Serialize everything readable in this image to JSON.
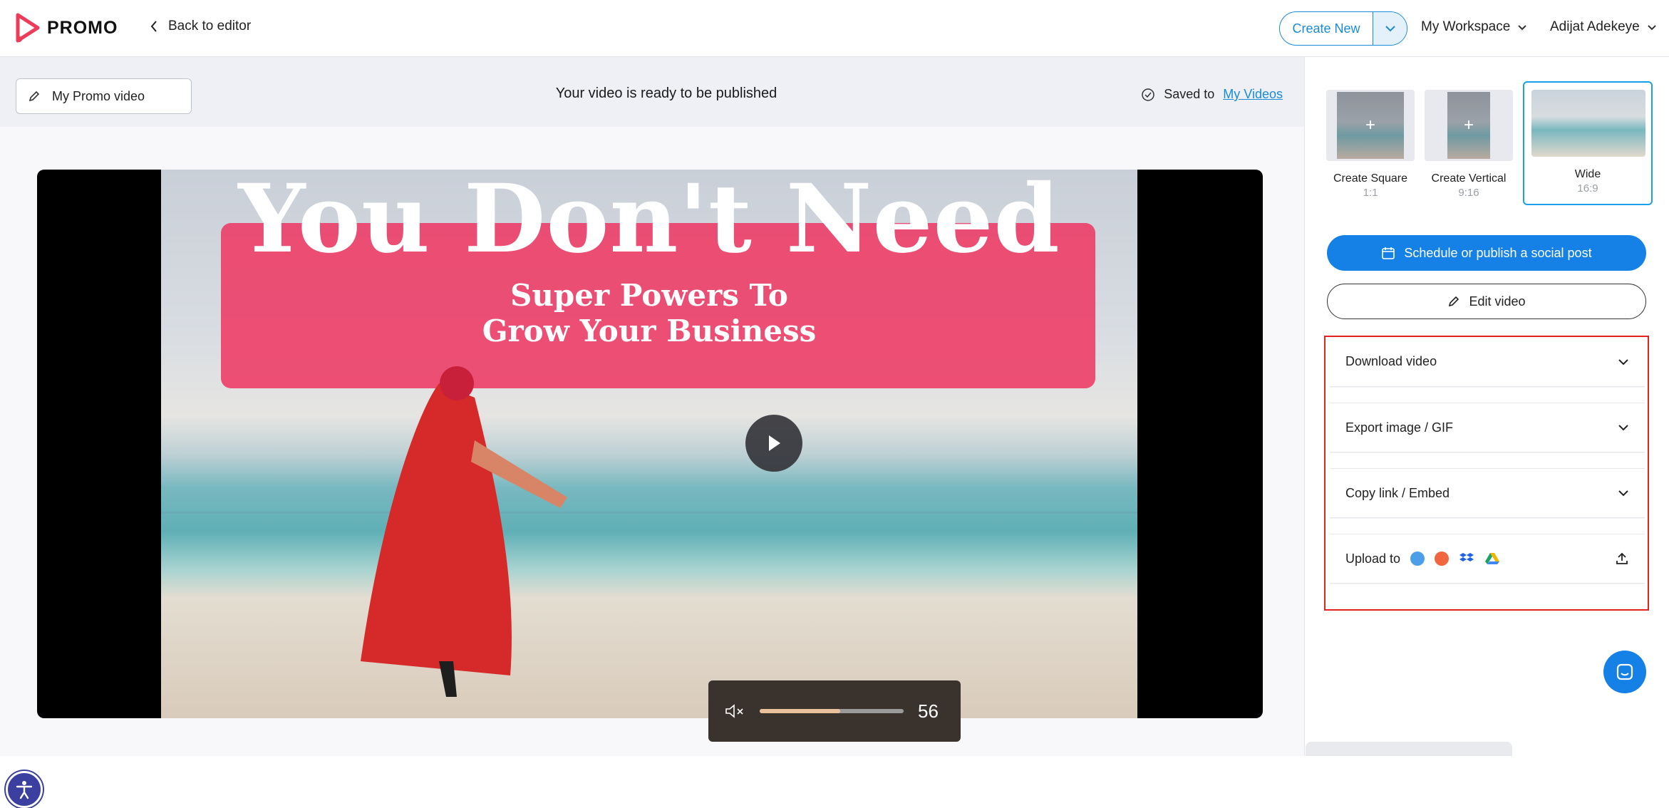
{
  "header": {
    "logo_text": "PROMO",
    "back_label": "Back to editor",
    "create_new_label": "Create New",
    "workspace_label": "My Workspace",
    "user_name": "Adijat Adekeye"
  },
  "subbar": {
    "video_title": "My Promo video",
    "status_message": "Your video is ready to be published",
    "saved_prefix": "Saved to",
    "saved_link": "My Videos"
  },
  "video": {
    "headline": "You Don't Need",
    "subline_1": "Super Powers To",
    "subline_2": "Grow Your Business"
  },
  "volume": {
    "value": "56",
    "level_fraction": 0.56
  },
  "formats": [
    {
      "label": "Create Square",
      "ratio": "1:1"
    },
    {
      "label": "Create Vertical",
      "ratio": "9:16"
    },
    {
      "label": "Wide",
      "ratio": "16:9"
    }
  ],
  "actions": {
    "schedule_label": "Schedule or publish a social post",
    "edit_label": "Edit video"
  },
  "options": {
    "download": "Download video",
    "export": "Export image / GIF",
    "copy_link": "Copy link / Embed",
    "upload": "Upload to"
  },
  "upload_services": [
    {
      "icon": "chat-service-icon",
      "color": "#4a9fe8"
    },
    {
      "icon": "hubspot-icon",
      "color": "#f0663f"
    },
    {
      "icon": "dropbox-icon",
      "color": "#1e63e6"
    },
    {
      "icon": "google-drive-icon",
      "color": "#f2b400"
    }
  ],
  "colors": {
    "accent": "#1580e5",
    "banner": "#ee3a64",
    "highlight_border": "#e02424"
  }
}
